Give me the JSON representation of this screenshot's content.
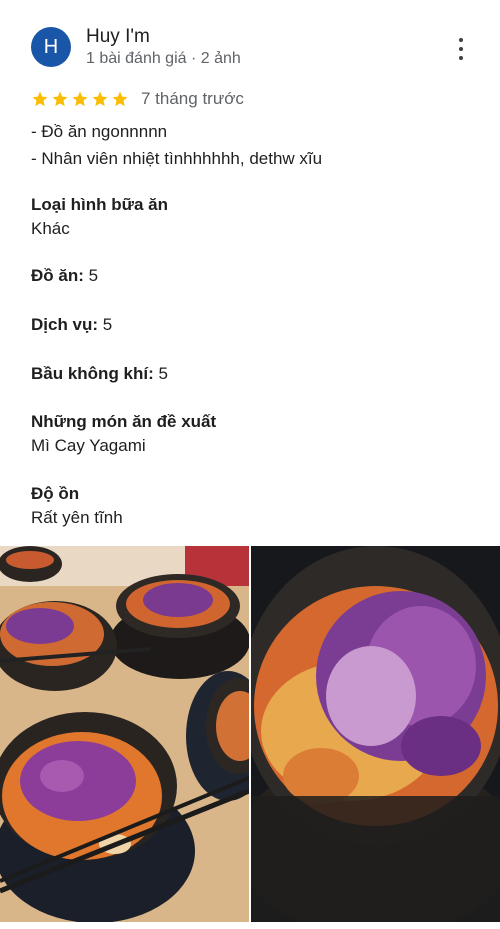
{
  "review": {
    "avatar_letter": "H",
    "reviewer_name": "Huy I'm",
    "reviewer_meta": "1 bài đánh giá · 2 ảnh",
    "rating": 5,
    "time_ago": "7 tháng trước",
    "text_lines": [
      "- Đồ ăn ngonnnnn",
      "- Nhân viên nhiệt tìnhhhhhh, dethw xĩu"
    ],
    "details": {
      "meal_type_label": "Loại hình bữa ăn",
      "meal_type_value": "Khác",
      "food_label": "Đồ ăn:",
      "food_value": "5",
      "service_label": "Dịch vụ:",
      "service_value": "5",
      "atmosphere_label": "Bầu không khí:",
      "atmosphere_value": "5",
      "recommended_label": "Những món ăn đề xuất",
      "recommended_value": "Mì Cay Yagami",
      "noise_label": "Độ ồn",
      "noise_value": "Rất yên tĩnh"
    }
  },
  "photos": [
    "photo-spicy-noodles-table",
    "photo-spicy-noodles-closeup"
  ],
  "colors": {
    "avatar": "#1a56a8",
    "star": "#fbbc04",
    "secondary_text": "#5f6368"
  }
}
